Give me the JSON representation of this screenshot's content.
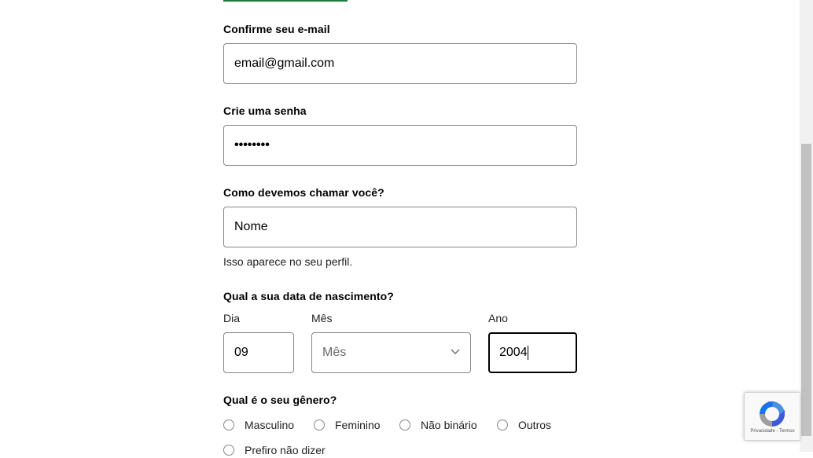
{
  "form": {
    "confirm_email": {
      "label": "Confirme seu e-mail",
      "value": "email@gmail.com"
    },
    "password": {
      "label": "Crie uma senha",
      "value": "••••••••"
    },
    "name": {
      "label": "Como devemos chamar você?",
      "value": "Nome",
      "hint": "Isso aparece no seu perfil."
    },
    "birthdate": {
      "label": "Qual a sua data de nascimento?",
      "day": {
        "label": "Dia",
        "value": "09"
      },
      "month": {
        "label": "Mês",
        "placeholder": "Mês"
      },
      "year": {
        "label": "Ano",
        "value": "2004"
      }
    },
    "gender": {
      "label": "Qual é o seu gênero?",
      "options": [
        "Masculino",
        "Feminino",
        "Não binário",
        "Outros",
        "Prefiro não dizer"
      ]
    }
  },
  "recaptcha": {
    "footer": "Privacidade - Termos",
    "icon": "recaptcha-logo-icon"
  },
  "colors": {
    "accent": "#1f7a3c",
    "border": "#878787",
    "active_border": "#000000"
  }
}
